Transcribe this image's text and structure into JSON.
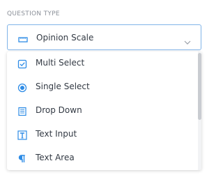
{
  "field": {
    "label": "QUESTION TYPE",
    "selected_value": "Opinion Scale",
    "selected_icon": "opinion-scale-icon"
  },
  "options": [
    {
      "label": "Multi Select",
      "icon": "checkbox-icon"
    },
    {
      "label": "Single Select",
      "icon": "radio-icon"
    },
    {
      "label": "Drop Down",
      "icon": "dropdown-list-icon"
    },
    {
      "label": "Text Input",
      "icon": "text-input-icon"
    },
    {
      "label": "Text Area",
      "icon": "paragraph-icon"
    }
  ],
  "colors": {
    "accent": "#2e8ce6",
    "border_focus": "#7fb3e8",
    "text": "#333a44",
    "label": "#8a8f98"
  }
}
